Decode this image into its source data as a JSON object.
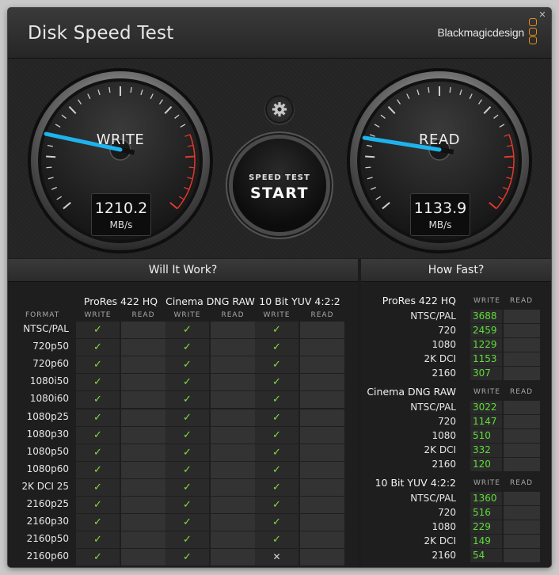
{
  "window": {
    "title": "Disk Speed Test",
    "brand": "Blackmagicdesign",
    "close_label": "✕"
  },
  "gauges": {
    "write": {
      "label": "WRITE",
      "value": "1210.2",
      "unit": "MB/s"
    },
    "read": {
      "label": "READ",
      "value": "1133.9",
      "unit": "MB/s"
    }
  },
  "start_button": {
    "small": "SPEED TEST",
    "big": "START"
  },
  "colors": {
    "needle": "#1fb3ee",
    "check": "#7ee23d",
    "value_green": "#5fdc3a",
    "logo_orange": "#e98e1c",
    "redline": "#e0392b"
  },
  "will_it_work": {
    "title": "Will It Work?",
    "format_header": "FORMAT",
    "write_header": "WRITE",
    "read_header": "READ",
    "codecs": [
      "ProRes 422 HQ",
      "Cinema DNG RAW",
      "10 Bit YUV 4:2:2"
    ],
    "formats": [
      "NTSC/PAL",
      "720p50",
      "720p60",
      "1080i50",
      "1080i60",
      "1080p25",
      "1080p30",
      "1080p50",
      "1080p60",
      "2K DCI 25",
      "2160p25",
      "2160p30",
      "2160p50",
      "2160p60"
    ],
    "results": [
      [
        "ok",
        "ok",
        "ok"
      ],
      [
        "ok",
        "ok",
        "ok"
      ],
      [
        "ok",
        "ok",
        "ok"
      ],
      [
        "ok",
        "ok",
        "ok"
      ],
      [
        "ok",
        "ok",
        "ok"
      ],
      [
        "ok",
        "ok",
        "ok"
      ],
      [
        "ok",
        "ok",
        "ok"
      ],
      [
        "ok",
        "ok",
        "ok"
      ],
      [
        "ok",
        "ok",
        "ok"
      ],
      [
        "ok",
        "ok",
        "ok"
      ],
      [
        "ok",
        "ok",
        "ok"
      ],
      [
        "ok",
        "ok",
        "ok"
      ],
      [
        "ok",
        "ok",
        "ok"
      ],
      [
        "ok",
        "ok",
        "no"
      ]
    ],
    "ok_symbol": "✓",
    "no_symbol": "✕"
  },
  "how_fast": {
    "title": "How Fast?",
    "write_header": "WRITE",
    "read_header": "READ",
    "groups": [
      {
        "name": "ProRes 422 HQ",
        "rows": [
          {
            "label": "NTSC/PAL",
            "write": "3688"
          },
          {
            "label": "720",
            "write": "2459"
          },
          {
            "label": "1080",
            "write": "1229"
          },
          {
            "label": "2K DCI",
            "write": "1153"
          },
          {
            "label": "2160",
            "write": "307"
          }
        ]
      },
      {
        "name": "Cinema DNG RAW",
        "rows": [
          {
            "label": "NTSC/PAL",
            "write": "3022"
          },
          {
            "label": "720",
            "write": "1147"
          },
          {
            "label": "1080",
            "write": "510"
          },
          {
            "label": "2K DCI",
            "write": "332"
          },
          {
            "label": "2160",
            "write": "120"
          }
        ]
      },
      {
        "name": "10 Bit YUV 4:2:2",
        "rows": [
          {
            "label": "NTSC/PAL",
            "write": "1360"
          },
          {
            "label": "720",
            "write": "516"
          },
          {
            "label": "1080",
            "write": "229"
          },
          {
            "label": "2K DCI",
            "write": "149"
          },
          {
            "label": "2160",
            "write": "54"
          }
        ]
      }
    ]
  }
}
